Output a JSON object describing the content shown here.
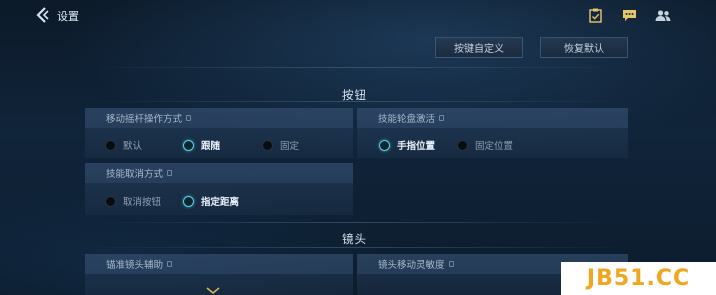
{
  "header": {
    "title": "设置",
    "icons": [
      "back-arrow-icon",
      "clipboard-check-icon",
      "chat-icon",
      "friends-icon"
    ]
  },
  "actions": {
    "customize_keys": "按键自定义",
    "restore_default": "恢复默认"
  },
  "sections": {
    "buttons_title": "按钮",
    "camera_title": "镜头"
  },
  "panels": {
    "joystick": {
      "label": "移动摇杆操作方式",
      "options": [
        "默认",
        "跟随",
        "固定"
      ],
      "selected": "跟随"
    },
    "skill_wheel": {
      "label": "技能轮盘激活",
      "options": [
        "手指位置",
        "固定位置"
      ],
      "selected": "手指位置"
    },
    "skill_cancel": {
      "label": "技能取消方式",
      "options": [
        "取消按钮",
        "指定距离"
      ],
      "selected": "指定距离"
    },
    "aim_assist": {
      "label": "锚准镜头辅助"
    },
    "camera_sensitivity": {
      "label": "镜头移动灵敏度"
    }
  },
  "watermark": "JB51.CC",
  "colors": {
    "accent": "#59d0e6",
    "watermark_text": "#f0a61e"
  }
}
